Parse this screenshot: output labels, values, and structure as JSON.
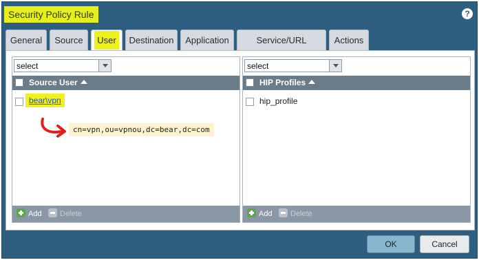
{
  "dialog": {
    "title": "Security Policy Rule",
    "help_label": "?"
  },
  "tabs": [
    {
      "label": "General",
      "active": false
    },
    {
      "label": "Source",
      "active": false
    },
    {
      "label": "User",
      "active": true
    },
    {
      "label": "Destination",
      "active": false
    },
    {
      "label": "Application",
      "active": false
    },
    {
      "label": "Service/URL Category",
      "active": false
    },
    {
      "label": "Actions",
      "active": false
    }
  ],
  "source_user": {
    "select_value": "select",
    "column_header": "Source User",
    "rows": [
      {
        "value": "bear\\vpn"
      }
    ],
    "annotation": "cn=vpn,ou=vpnou,dc=bear,dc=com",
    "add_label": "Add",
    "delete_label": "Delete"
  },
  "hip_profiles": {
    "select_value": "select",
    "column_header": "HIP Profiles",
    "rows": [
      {
        "value": "hip_profile"
      }
    ],
    "add_label": "Add",
    "delete_label": "Delete"
  },
  "buttons": {
    "ok": "OK",
    "cancel": "Cancel"
  },
  "colors": {
    "dialog_bg": "#2f5f80",
    "highlight": "#e6ee1c",
    "grid_header": "#6a7b8a",
    "annotation_arrow": "#e0201a"
  }
}
